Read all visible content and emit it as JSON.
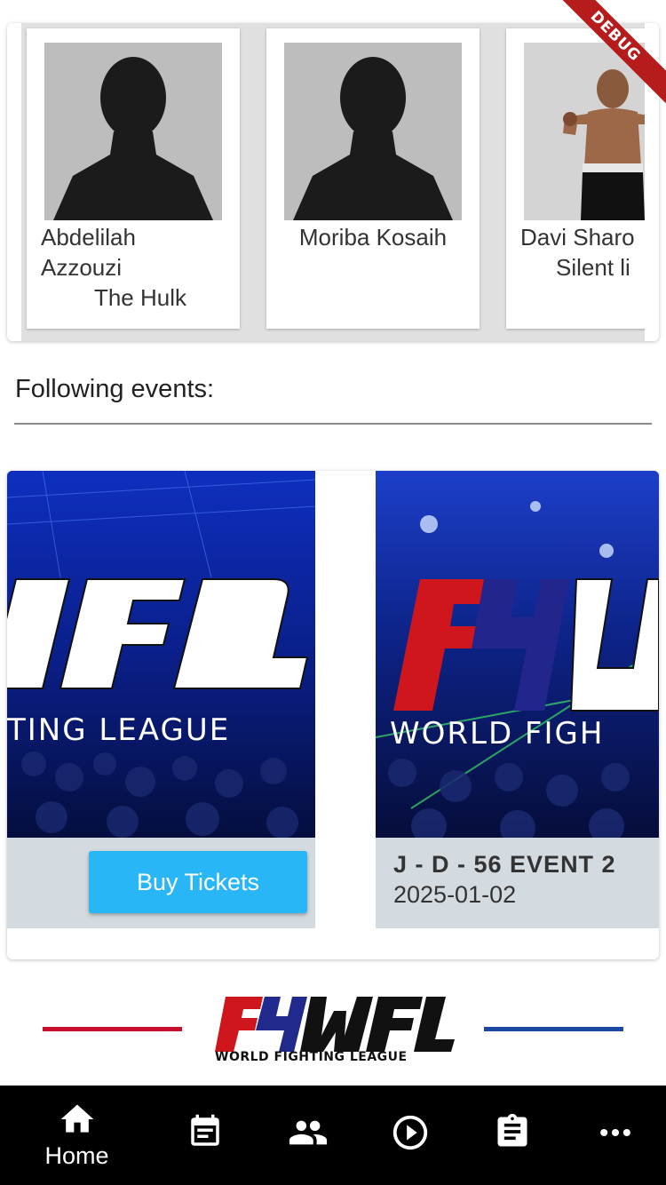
{
  "fighters": [
    {
      "name_line1": "Abdelilah",
      "name_line2": "Azzouzi",
      "nickname": "The Hulk",
      "photo": "placeholder-silhouette"
    },
    {
      "name_line1": "Moriba Kosaih",
      "name_line2": "",
      "nickname": "",
      "photo": "placeholder-silhouette"
    },
    {
      "name_line1": "Davi Sharo",
      "name_line2": "",
      "nickname": "Silent li",
      "photo": "fighter-photo"
    }
  ],
  "events_section": {
    "title": "Following events:"
  },
  "events": [
    {
      "banner_text": "TING LEAGUE",
      "banner_logo": "IFL",
      "button_label": "Buy Tickets"
    },
    {
      "banner_text": "WORLD FIGH",
      "banner_logo": "FHU",
      "title": "J - D - 56 EVENT 2",
      "date": "2025-01-02"
    }
  ],
  "logo": {
    "text": "WFL",
    "subtitle": "WORLD FIGHTING LEAGUE"
  },
  "debug_banner": "DEBUG",
  "bottom_nav": [
    {
      "icon": "home-icon",
      "label": "Home"
    },
    {
      "icon": "calendar-icon",
      "label": ""
    },
    {
      "icon": "people-icon",
      "label": ""
    },
    {
      "icon": "play-icon",
      "label": ""
    },
    {
      "icon": "clipboard-icon",
      "label": ""
    },
    {
      "icon": "more-icon",
      "label": ""
    }
  ],
  "colors": {
    "accent_blue": "#29b6f6",
    "brand_red": "#c8102e",
    "brand_blue": "#1a47a0",
    "nav_bg": "#000000"
  }
}
